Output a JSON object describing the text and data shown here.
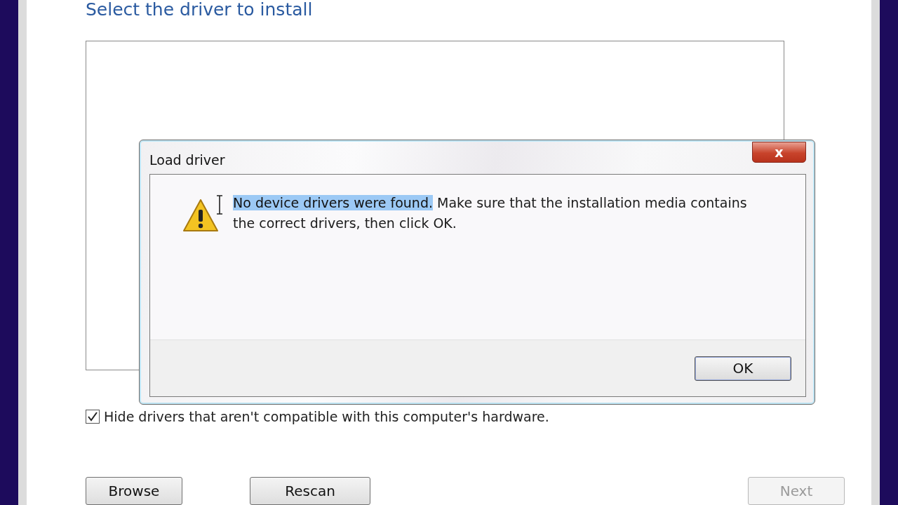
{
  "page": {
    "title": "Select the driver to install"
  },
  "hide_incompatible": {
    "label": "Hide drivers that aren't compatible with this computer's hardware.",
    "checked": true
  },
  "buttons": [
    {
      "label": "Browse",
      "disabled": false
    },
    {
      "label": "Rescan",
      "disabled": false
    },
    {
      "label": "Next",
      "disabled": true
    }
  ],
  "dialog": {
    "title": "Load driver",
    "close": "x",
    "selected_text": "No device drivers were found.",
    "message": "Make sure that the installation media contains the correct drivers, then click OK.",
    "ok": "OK"
  }
}
